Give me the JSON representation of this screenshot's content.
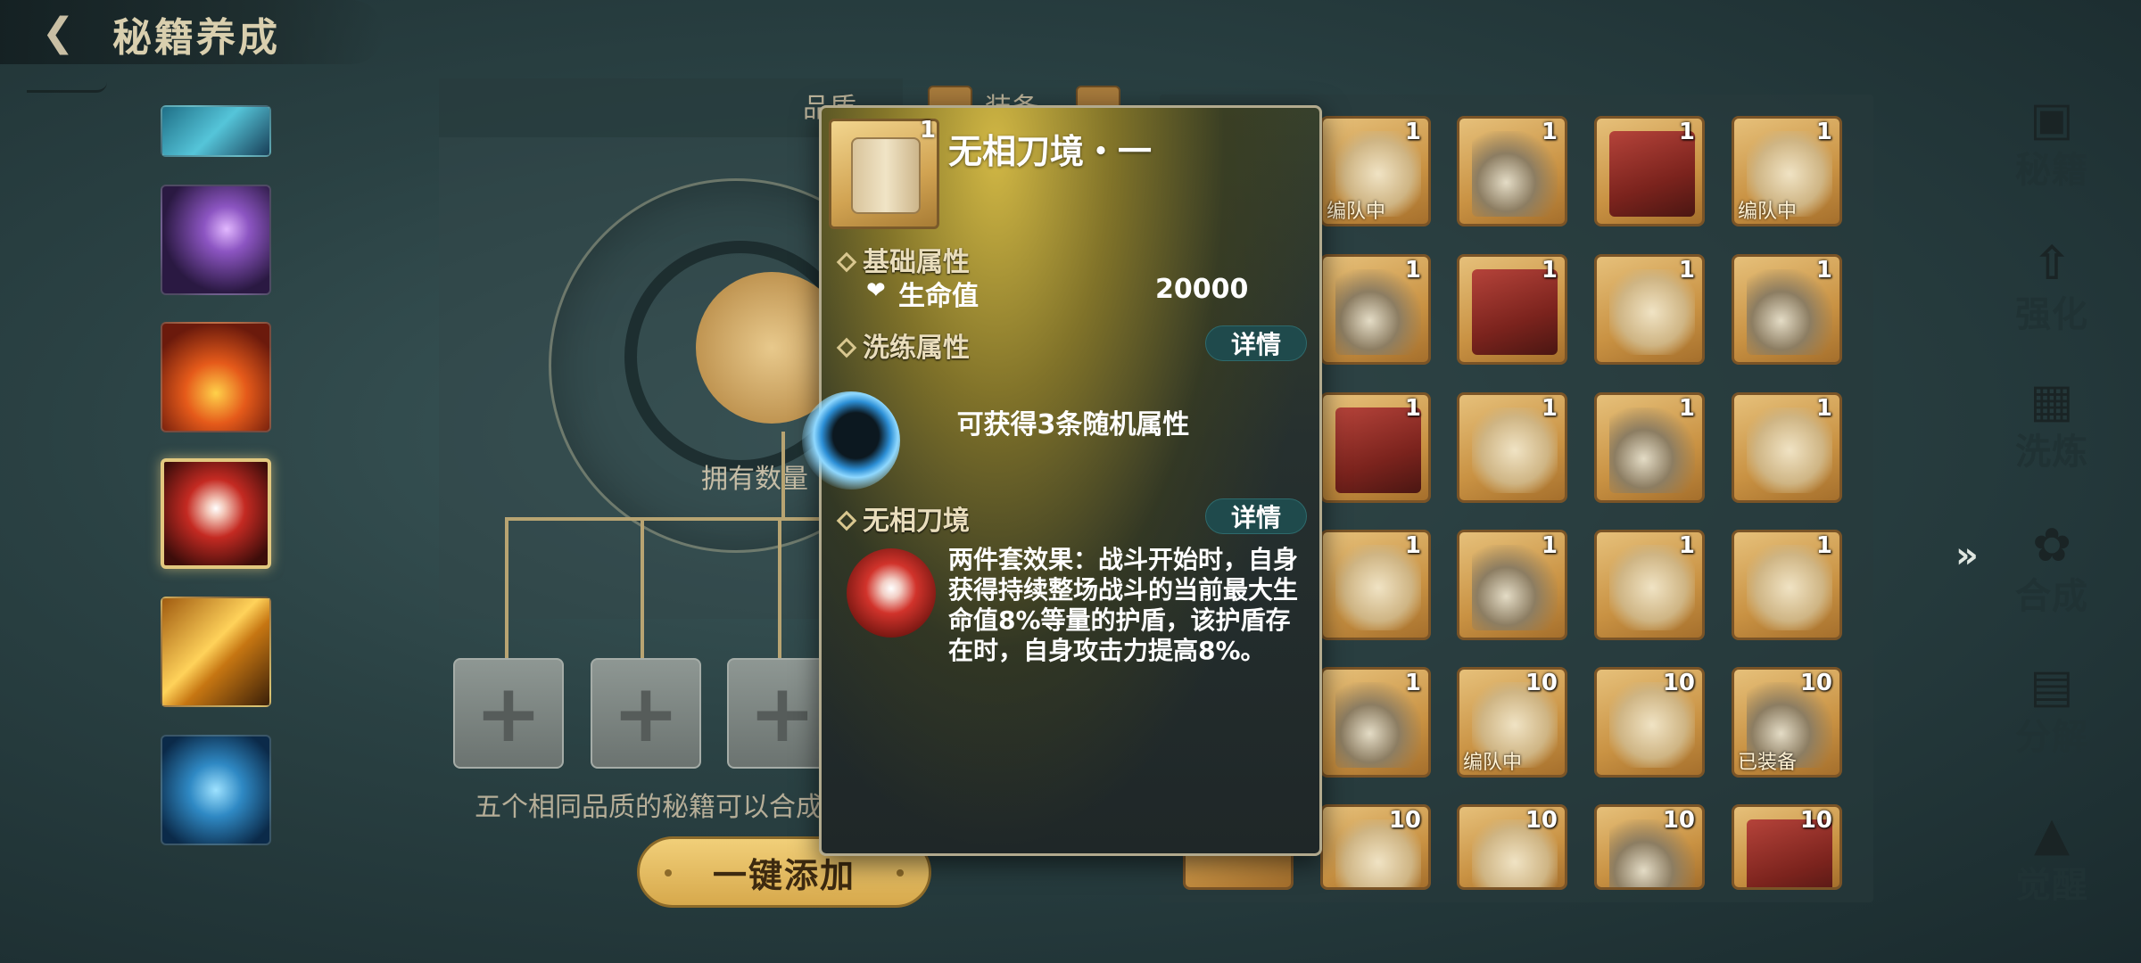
{
  "header": {
    "title": "秘籍养成"
  },
  "filters": {
    "quality": "品质",
    "status": "装备"
  },
  "synthesis": {
    "owned_label": "拥有数量",
    "slot_symbol": "+",
    "hint": "五个相同品质的秘籍可以合成",
    "one_click_add": "一键添加"
  },
  "inventory": {
    "rows": [
      [
        {
          "count": "1",
          "tag": "编队中"
        },
        {
          "count": "1",
          "tag": ""
        },
        {
          "count": "1",
          "tag": ""
        },
        {
          "count": "1",
          "tag": "编队中"
        }
      ],
      [
        {
          "count": "1",
          "tag": ""
        },
        {
          "count": "1",
          "tag": ""
        },
        {
          "count": "1",
          "tag": ""
        },
        {
          "count": "1",
          "tag": ""
        }
      ],
      [
        {
          "count": "1",
          "tag": ""
        },
        {
          "count": "1",
          "tag": ""
        },
        {
          "count": "1",
          "tag": ""
        },
        {
          "count": "1",
          "tag": ""
        }
      ],
      [
        {
          "count": "1",
          "tag": ""
        },
        {
          "count": "1",
          "tag": ""
        },
        {
          "count": "1",
          "tag": ""
        },
        {
          "count": "1",
          "tag": ""
        }
      ],
      [
        {
          "count": "1",
          "tag": ""
        },
        {
          "count": "10",
          "tag": "编队中"
        },
        {
          "count": "10",
          "tag": ""
        },
        {
          "count": "10",
          "tag": "已装备"
        }
      ],
      [
        {
          "count": "10",
          "tag": ""
        },
        {
          "count": "10",
          "tag": ""
        },
        {
          "count": "10",
          "tag": ""
        },
        {
          "count": "10",
          "tag": ""
        }
      ]
    ]
  },
  "nav": {
    "items": [
      {
        "label": "秘籍",
        "icon": "book-icon"
      },
      {
        "label": "强化",
        "icon": "upgrade-icon"
      },
      {
        "label": "洗炼",
        "icon": "refine-icon"
      },
      {
        "label": "合成",
        "icon": "triskelion-icon"
      },
      {
        "label": "分解",
        "icon": "decompose-icon"
      },
      {
        "label": "觉醒",
        "icon": "awaken-icon"
      }
    ],
    "expand_symbol": "»"
  },
  "tooltip": {
    "item_name": "无相刀境・一",
    "item_count": "1",
    "base_attr_title": "基础属性",
    "hp_label": "生命值",
    "hp_value": "20000",
    "refine_attr_title": "洗练属性",
    "detail_label": "详情",
    "random_attr_text": "可获得3条随机属性",
    "set_title": "无相刀境",
    "set_desc": "两件套效果：战斗开始时，自身获得持续整场战斗的当前最大生命值8%等量的护盾，该护盾存在时，自身攻击力提高8%。"
  },
  "colors": {
    "accent_gold": "#e2c87f",
    "detail_button": "#1f4a4c",
    "panel_bg": "#26302f"
  }
}
